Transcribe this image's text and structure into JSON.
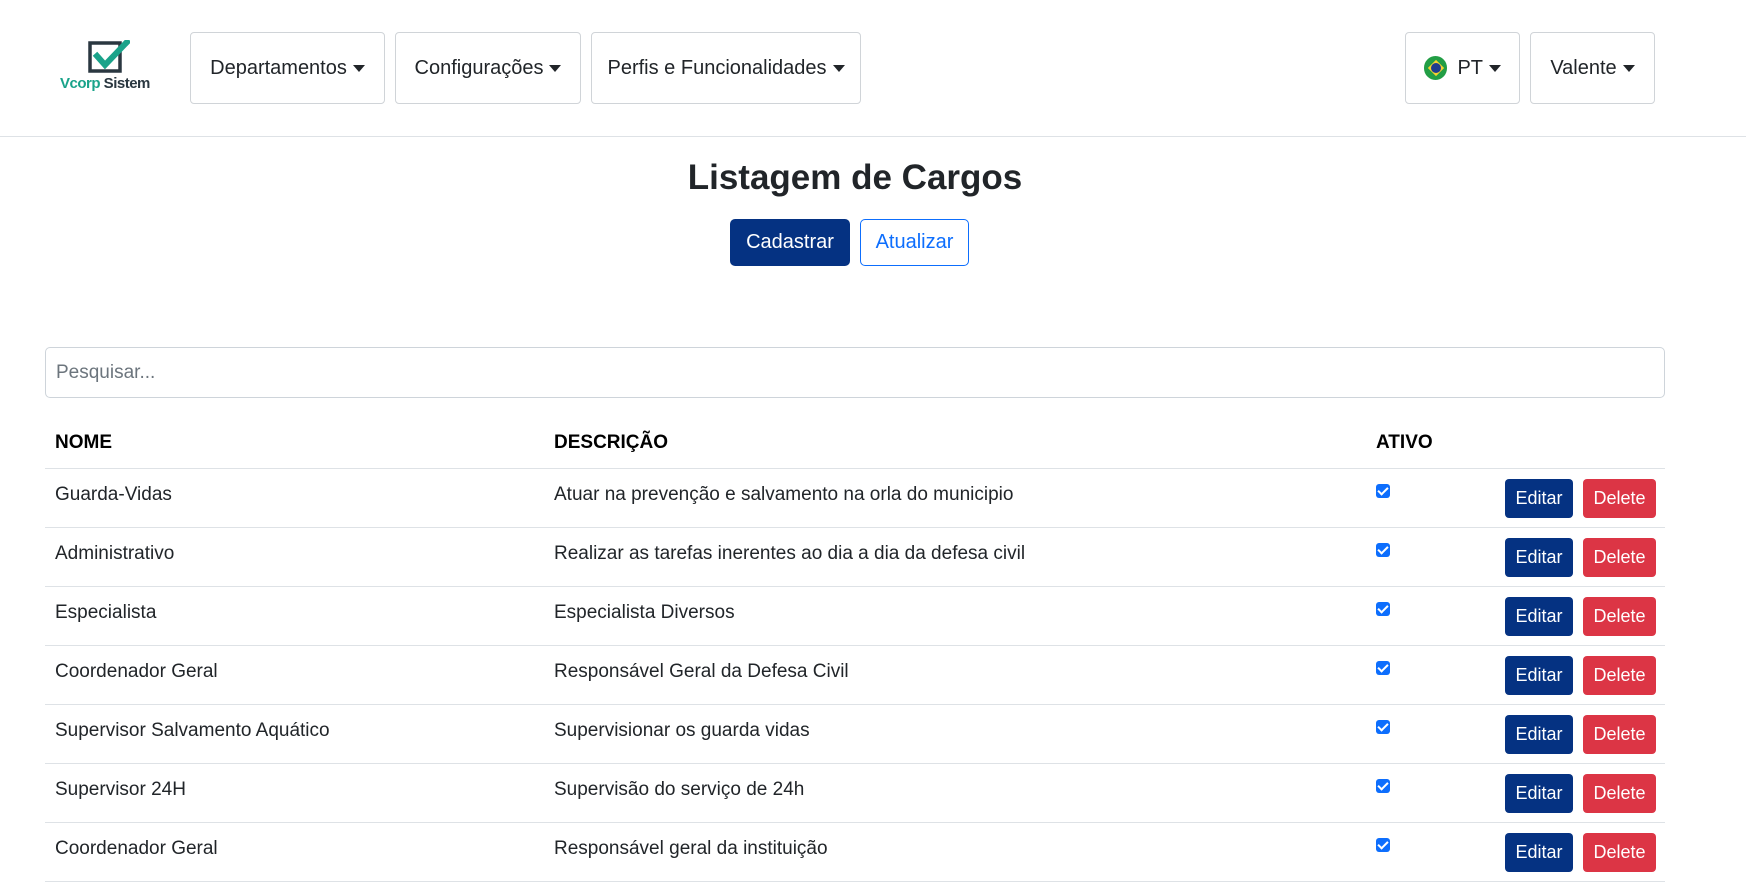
{
  "brand": {
    "name_part1": "Vcorp",
    "name_part2": " Sistem"
  },
  "nav": {
    "departamentos": "Departamentos",
    "configuracoes": "Configurações",
    "perfis": "Perfis e Funcionalidades",
    "language": "PT",
    "user": "Valente"
  },
  "page": {
    "title": "Listagem de Cargos",
    "cadastrar": "Cadastrar",
    "atualizar": "Atualizar"
  },
  "search": {
    "placeholder": "Pesquisar..."
  },
  "table": {
    "headers": {
      "nome": "NOME",
      "descricao": "DESCRIÇÃO",
      "ativo": "ATIVO"
    },
    "edit_label": "Editar",
    "delete_label": "Delete",
    "rows": [
      {
        "nome": "Guarda-Vidas",
        "descricao": "Atuar na prevenção e salvamento na orla do municipio",
        "ativo": true
      },
      {
        "nome": "Administrativo",
        "descricao": "Realizar as tarefas inerentes ao dia a dia da defesa civil",
        "ativo": true
      },
      {
        "nome": "Especialista",
        "descricao": "Especialista Diversos",
        "ativo": true
      },
      {
        "nome": "Coordenador Geral",
        "descricao": "Responsável Geral da Defesa Civil",
        "ativo": true
      },
      {
        "nome": "Supervisor Salvamento Aquático",
        "descricao": "Supervisionar os guarda vidas",
        "ativo": true
      },
      {
        "nome": "Supervisor 24H",
        "descricao": "Supervisão do serviço de 24h",
        "ativo": true
      },
      {
        "nome": "Coordenador Geral",
        "descricao": "Responsável geral da instituição",
        "ativo": true
      }
    ]
  },
  "colors": {
    "primary": "#053282",
    "danger": "#dc3545",
    "outline": "#0d6efd",
    "brand_green": "#1aa38a"
  }
}
